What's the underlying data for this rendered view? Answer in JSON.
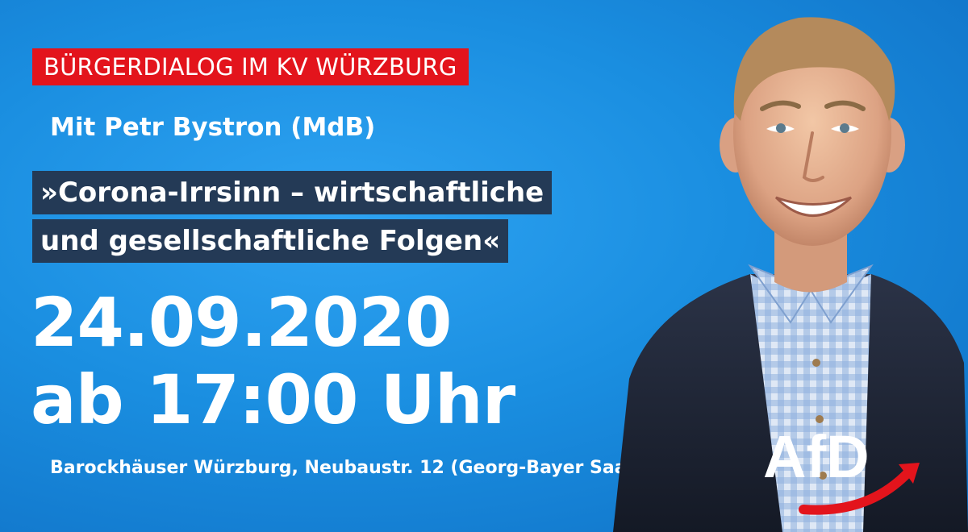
{
  "event_type": "BÜRGERDIALOG IM KV WÜRZBURG",
  "speaker": "Mit Petr Bystron (MdB)",
  "topic": {
    "line1": "»Corona-Irrsinn – wirtschaftliche",
    "line2": "und gesellschaftliche Folgen«"
  },
  "date": "24.09.2020",
  "time": "ab 17:00 Uhr",
  "venue": "Barockhäuser Würzburg, Neubaustr. 12 (Georg-Bayer Saal)",
  "logo_text": "AfD",
  "colors": {
    "background": "#1a8ee0",
    "accent_red": "#e3141c",
    "topic_box": "#243a56",
    "text": "#ffffff"
  }
}
